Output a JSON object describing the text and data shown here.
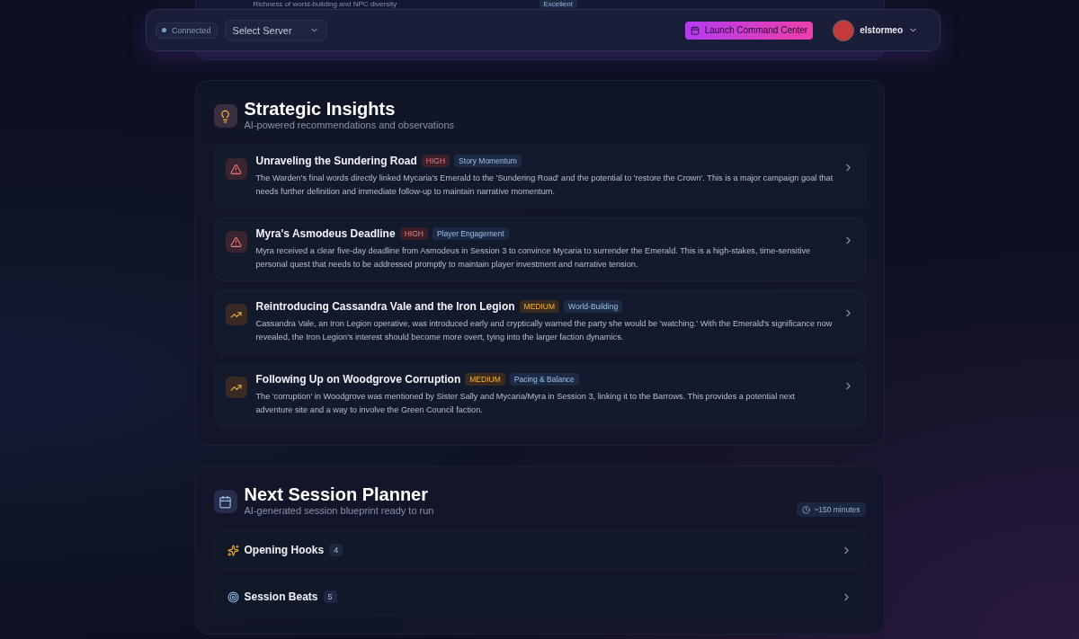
{
  "top_card": {
    "description": "Richness of world-building and NPC diversity",
    "rating": "Excellent"
  },
  "navbar": {
    "status": {
      "label": "Connected",
      "connected": true
    },
    "server_select": {
      "placeholder": "Select Server"
    },
    "launch_button": "Launch Command Center",
    "user": {
      "name": "elstormeo"
    }
  },
  "insights": {
    "title": "Strategic Insights",
    "subtitle": "AI-powered recommendations and observations",
    "items": [
      {
        "kind": "high",
        "title": "Unraveling the Sundering Road",
        "priority": "HIGH",
        "category": "Story Momentum",
        "text": "The Warden's final words directly linked Mycaria's Emerald to the 'Sundering Road' and the potential to 'restore the Crown'. This is a major campaign goal that needs further definition and immediate follow-up to maintain narrative momentum."
      },
      {
        "kind": "high",
        "title": "Myra's Asmodeus Deadline",
        "priority": "HIGH",
        "category": "Player Engagement",
        "text": "Myra received a clear five-day deadline from Asmodeus in Session 3 to convince Mycaria to surrender the Emerald. This is a high-stakes, time-sensitive personal quest that needs to be addressed promptly to maintain player investment and narrative tension."
      },
      {
        "kind": "medium",
        "title": "Reintroducing Cassandra Vale and the Iron Legion",
        "priority": "MEDIUM",
        "category": "World-Building",
        "text": "Cassandra Vale, an Iron Legion operative, was introduced early and cryptically warned the party she would be 'watching.' With the Emerald's significance now revealed, the Iron Legion's interest should become more overt, tying into the larger faction dynamics."
      },
      {
        "kind": "medium",
        "title": "Following Up on Woodgrove Corruption",
        "priority": "MEDIUM",
        "category": "Pacing & Balance",
        "text": "The 'corruption' in Woodgrove was mentioned by Sister Sally and Mycaria/Myra in Session 3, linking it to the Barrows. This provides a potential next adventure site and a way to involve the Green Council faction."
      }
    ]
  },
  "planner": {
    "title": "Next Session Planner",
    "subtitle": "AI-generated session blueprint ready to run",
    "duration": "~150 minutes",
    "sections": [
      {
        "kind": "hooks",
        "label": "Opening Hooks",
        "count": "4",
        "expanded": false
      },
      {
        "kind": "beats",
        "label": "Session Beats",
        "count": "5",
        "expanded": false
      }
    ]
  }
}
